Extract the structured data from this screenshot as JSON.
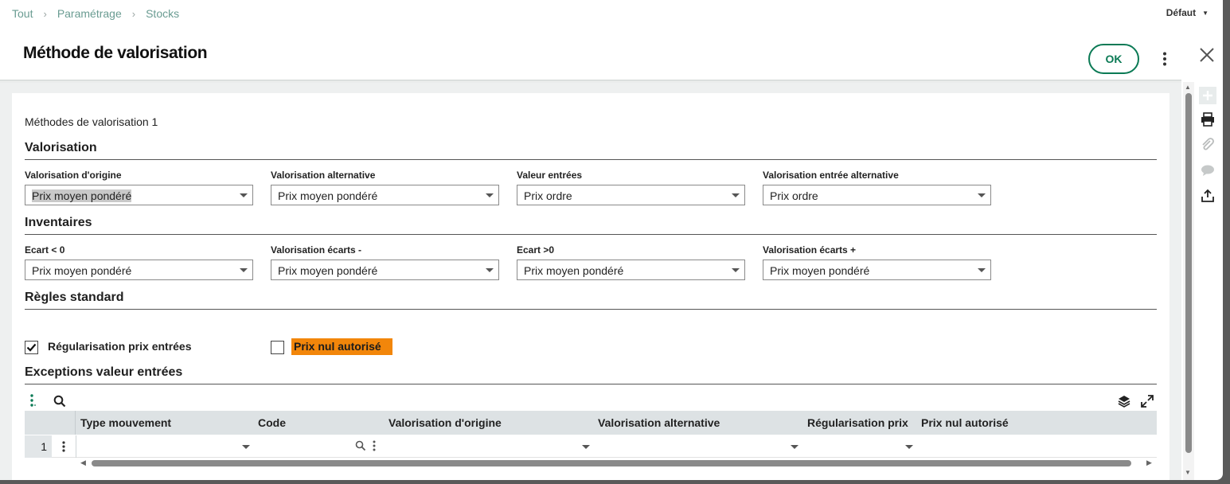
{
  "breadcrumb": [
    "Tout",
    "Paramétrage",
    "Stocks"
  ],
  "profile": "Défaut",
  "title": "Méthode de valorisation",
  "actions": {
    "ok": "OK"
  },
  "record_label": "Méthodes de valorisation 1",
  "sections": {
    "valorisation": "Valorisation",
    "inventaires": "Inventaires",
    "regles": "Règles standard",
    "exceptions": "Exceptions valeur entrées"
  },
  "valorisation_fields": [
    {
      "label": "Valorisation d'origine",
      "value": "Prix moyen pondéré"
    },
    {
      "label": "Valorisation alternative",
      "value": "Prix moyen pondéré"
    },
    {
      "label": "Valeur entrées",
      "value": "Prix ordre"
    },
    {
      "label": "Valorisation entrée alternative",
      "value": "Prix ordre"
    }
  ],
  "inventaires_fields": [
    {
      "label": "Ecart < 0",
      "value": "Prix moyen pondéré"
    },
    {
      "label": "Valorisation écarts -",
      "value": "Prix moyen pondéré"
    },
    {
      "label": "Ecart >0",
      "value": "Prix moyen pondéré"
    },
    {
      "label": "Valorisation écarts +",
      "value": "Prix moyen pondéré"
    }
  ],
  "checkboxes": [
    {
      "label": "Régularisation prix entrées",
      "checked": true
    },
    {
      "label": "Prix nul autorisé",
      "checked": false,
      "highlight": "#f2860a"
    }
  ],
  "grid": {
    "columns": [
      "Type mouvement",
      "Code",
      "Valorisation d'origine",
      "Valorisation alternative",
      "Régularisation prix",
      "Prix nul autorisé"
    ],
    "rows": [
      {
        "num": "1"
      }
    ]
  },
  "sidebar_icons": [
    "add-icon",
    "print-icon",
    "attachment-icon",
    "comment-icon",
    "share-icon"
  ],
  "colors": {
    "accent": "#0b7a55",
    "breadcrumb": "#6a9c92",
    "warning": "#f2860a"
  }
}
